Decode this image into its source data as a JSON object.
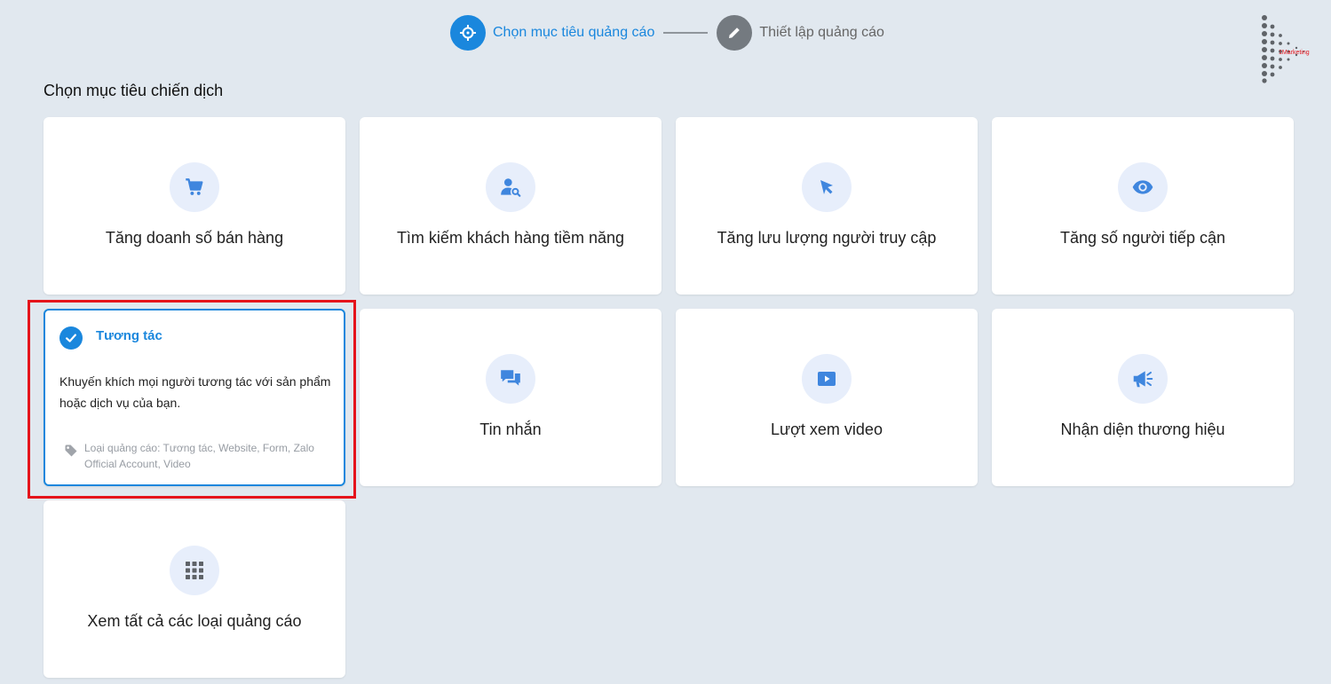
{
  "stepper": {
    "step1_label": "Chọn mục tiêu quảng cáo",
    "step2_label": "Thiết lập quảng cáo"
  },
  "logo": {
    "text": "1Marketing"
  },
  "page_title": "Chọn mục tiêu chiến dịch",
  "cards": [
    {
      "label": "Tăng doanh số bán hàng",
      "icon": "cart-icon"
    },
    {
      "label": "Tìm kiếm khách hàng tiềm năng",
      "icon": "user-search-icon"
    },
    {
      "label": "Tăng lưu lượng người truy cập",
      "icon": "cursor-icon"
    },
    {
      "label": "Tăng số người tiếp cận",
      "icon": "eye-icon"
    },
    {
      "label": "Tin nhắn",
      "icon": "chat-icon"
    },
    {
      "label": "Lượt xem video",
      "icon": "video-play-icon"
    },
    {
      "label": "Nhận diện thương hiệu",
      "icon": "megaphone-icon"
    },
    {
      "label": "Xem tất cả các loại quảng cáo",
      "icon": "grid-icon"
    }
  ],
  "selected_card": {
    "title": "Tương tác",
    "description": "Khuyến khích mọi người tương tác với sản phẩm hoặc dịch vụ của bạn.",
    "ad_types": "Loại quảng cáo: Tương tác, Website, Form, Zalo Official Account, Video",
    "icon": "check-circle-icon"
  },
  "colors": {
    "accent": "#1a87dd",
    "icon_blue": "#3f86de",
    "background": "#e1e8ef",
    "highlight": "#e5141b"
  }
}
